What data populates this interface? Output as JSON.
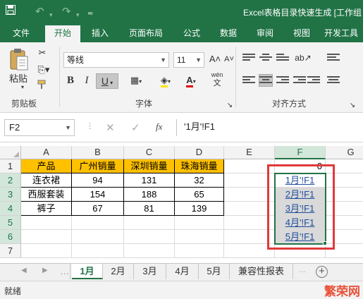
{
  "titlebar": {
    "save_icon": "save-icon",
    "title": "Excel表格目录快速生成 [工作组"
  },
  "tabs": [
    "文件",
    "开始",
    "插入",
    "页面布局",
    "公式",
    "数据",
    "审阅",
    "视图",
    "开发工具"
  ],
  "ribbon": {
    "paste_label": "粘贴",
    "clipboard_label": "剪贴板",
    "font_name": "等线",
    "font_size": "11",
    "font_label": "字体",
    "bold": "B",
    "italic": "I",
    "underline": "U",
    "grow_font": "A˄",
    "shrink_font": "A˅",
    "phonetic": "wén",
    "align_label": "对齐方式"
  },
  "formula_bar": {
    "name_box": "F2",
    "cancel": "✕",
    "enter": "✓",
    "fx": "fx",
    "formula": "'1月'!F1"
  },
  "sheet": {
    "columns": [
      "A",
      "B",
      "C",
      "D",
      "E",
      "F",
      "G"
    ],
    "rows": [
      "1",
      "2",
      "3",
      "4",
      "5",
      "6",
      "7"
    ],
    "header": [
      "产品",
      "广州销量",
      "深圳销量",
      "珠海销量"
    ],
    "data": [
      [
        "连衣裙",
        "94",
        "131",
        "32"
      ],
      [
        "西服套装",
        "154",
        "188",
        "65"
      ],
      [
        "裤子",
        "67",
        "81",
        "139"
      ]
    ],
    "f1_value": "0",
    "links": [
      "1月'!F1",
      "2月'!F1",
      "3月'!F1",
      "4月'!F1",
      "5月'!F1"
    ],
    "selected_col": "F",
    "selected_rows": [
      "2",
      "3",
      "4",
      "5",
      "6"
    ]
  },
  "sheet_tabs": [
    "1月",
    "2月",
    "3月",
    "4月",
    "5月",
    "兼容性报表"
  ],
  "active_sheet": "1月",
  "status": "就绪",
  "watermark": "繁荣网",
  "colors": {
    "accent": "#217346",
    "header_fill": "#ffc000",
    "highlight_box": "#e03a3a",
    "link": "#1f4e9c"
  }
}
